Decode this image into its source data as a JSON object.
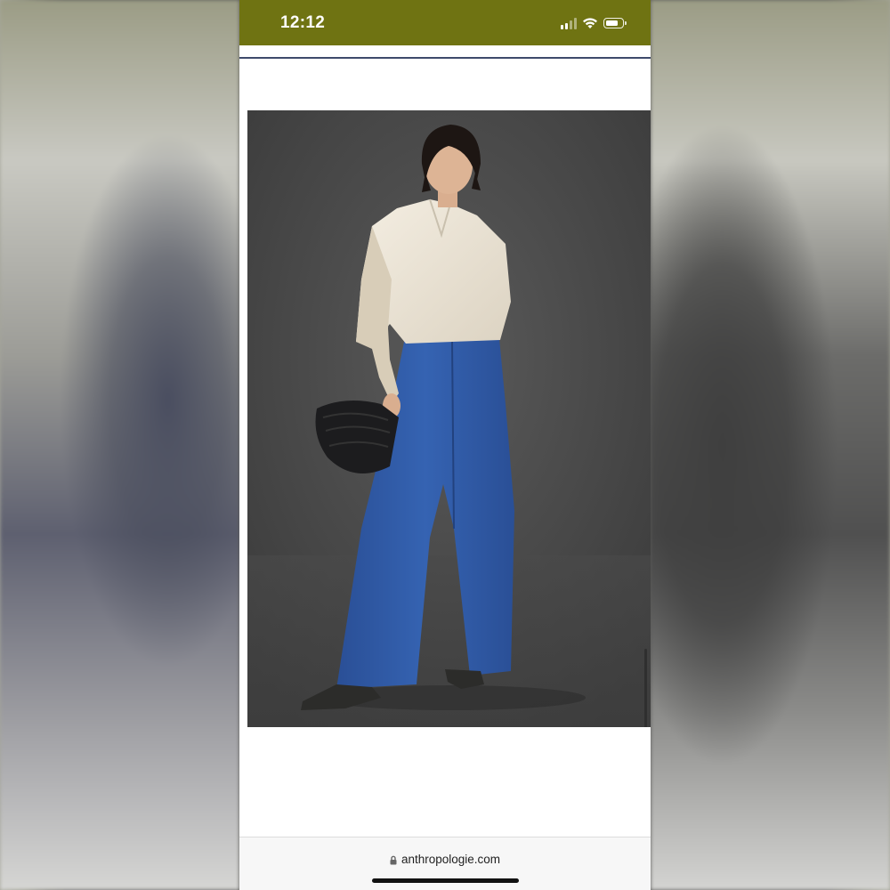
{
  "status_bar": {
    "time": "12:12",
    "signal_icon": "cellular-signal-icon",
    "wifi_icon": "wifi-icon",
    "battery_icon": "battery-icon",
    "battery_level": 0.8,
    "background_color": "#6f7312"
  },
  "product": {
    "image_icon": "product-photo"
  },
  "browser": {
    "url": "anthropologie.com",
    "lock_icon": "lock-icon"
  }
}
